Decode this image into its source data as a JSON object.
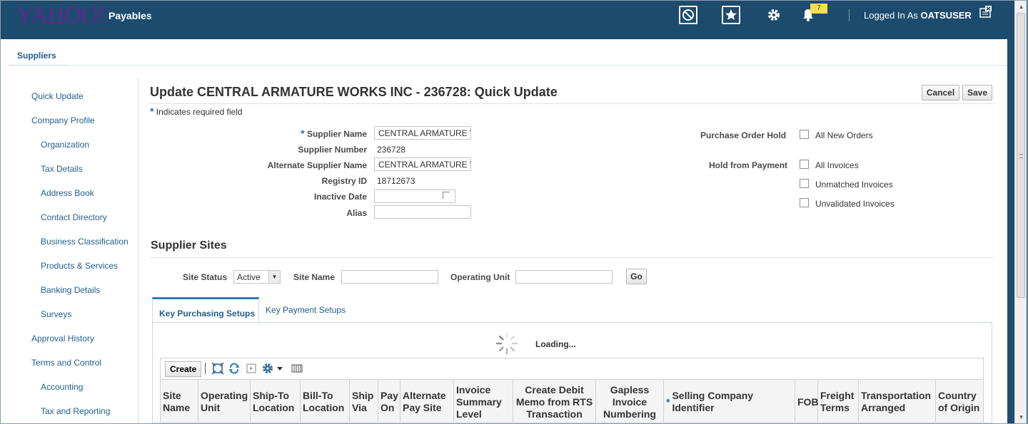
{
  "header": {
    "logo": "YAHOO!",
    "app_name": "Payables",
    "notification_count": "7",
    "logged_in_prefix": "Logged In As",
    "user": "OATSUSER",
    "icons": [
      "no-entry-icon",
      "favorites-star-icon",
      "settings-gear-icon",
      "notification-bell-icon",
      "close-icon"
    ]
  },
  "tabs": {
    "suppliers": "Suppliers"
  },
  "sidenav": {
    "quick_update": "Quick Update",
    "company_profile": "Company Profile",
    "organization": "Organization",
    "tax_details": "Tax Details",
    "address_book": "Address Book",
    "contact_directory": "Contact Directory",
    "business_classification": "Business Classification",
    "products_services": "Products & Services",
    "banking_details": "Banking Details",
    "surveys": "Surveys",
    "approval_history": "Approval History",
    "terms_and_control": "Terms and Control",
    "accounting": "Accounting",
    "tax_and_reporting": "Tax and Reporting"
  },
  "page": {
    "title": "Update CENTRAL ARMATURE WORKS INC - 236728: Quick Update",
    "cancel": "Cancel",
    "save": "Save",
    "required_star": "*",
    "required_note": "Indicates required field"
  },
  "form": {
    "supplier_name_label": "Supplier Name",
    "supplier_name_value": "CENTRAL ARMATURE WORKS INC",
    "supplier_number_label": "Supplier Number",
    "supplier_number_value": "236728",
    "alternate_name_label": "Alternate Supplier Name",
    "alternate_name_value": "CENTRAL ARMATURE WORKS INC",
    "registry_id_label": "Registry ID",
    "registry_id_value": "18712673",
    "inactive_date_label": "Inactive Date",
    "inactive_date_value": "",
    "alias_label": "Alias",
    "alias_value": "",
    "po_hold_label": "Purchase Order Hold",
    "all_new_orders": "All New Orders",
    "hold_payment_label": "Hold from Payment",
    "all_invoices": "All Invoices",
    "unmatched_invoices": "Unmatched Invoices",
    "unvalidated_invoices": "Unvalidated Invoices"
  },
  "sites": {
    "heading": "Supplier Sites",
    "site_status_label": "Site Status",
    "site_status_value": "Active",
    "site_name_label": "Site Name",
    "site_name_value": "",
    "operating_unit_label": "Operating Unit",
    "operating_unit_value": "",
    "go": "Go",
    "tab_purchasing": "Key Purchasing Setups",
    "tab_payment": "Key Payment Setups",
    "loading": "Loading...",
    "create": "Create",
    "toolbar_icons": [
      "detach-icon",
      "refresh-icon",
      "revert-icon",
      "settings-gear-icon",
      "columns-icon"
    ],
    "columns": {
      "site_name": "Site Name",
      "operating_unit": "Operating Unit",
      "ship_to": "Ship-To Location",
      "bill_to": "Bill-To Location",
      "ship_via": "Ship Via",
      "pay_on": "Pay On",
      "alt_pay_site": "Alternate Pay Site",
      "inv_summary": "Invoice Summary Level",
      "debit_memo": "Create Debit Memo from RTS Transaction",
      "gapless": "Gapless Invoice Numbering",
      "selling_company": "Selling Company Identifier",
      "fob": "FOB",
      "freight": "Freight Terms",
      "transport": "Transportation Arranged",
      "country": "Country of Origin"
    }
  }
}
